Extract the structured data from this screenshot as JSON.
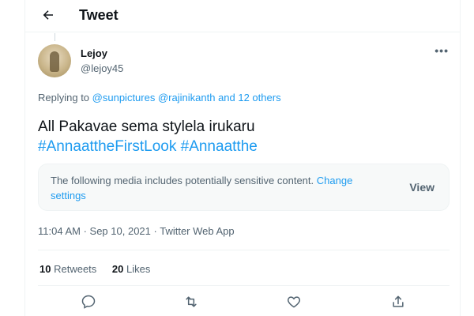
{
  "header": {
    "title": "Tweet"
  },
  "author": {
    "name": "Lejoy",
    "handle": "@lejoy45"
  },
  "reply": {
    "prefix": "Replying to",
    "mention1": "@sunpictures",
    "mention2": "@rajinikanth",
    "rest": "and 12 others"
  },
  "tweet": {
    "text": "All Pakavae sema stylela irukaru",
    "hashtag1": "#AnnaattheFirstLook",
    "hashtag2": "#Annaatthe"
  },
  "warning": {
    "message": "The following media includes potentially sensitive content.",
    "link": "Change settings",
    "view_label": "View"
  },
  "meta": {
    "time": "11:04 AM",
    "date": "Sep 10, 2021",
    "source": "Twitter Web App"
  },
  "stats": {
    "retweets_count": "10",
    "retweets_label": "Retweets",
    "likes_count": "20",
    "likes_label": "Likes"
  },
  "icons": [
    "back-arrow-icon",
    "more-icon",
    "reply-icon",
    "retweet-icon",
    "like-icon",
    "share-icon"
  ]
}
